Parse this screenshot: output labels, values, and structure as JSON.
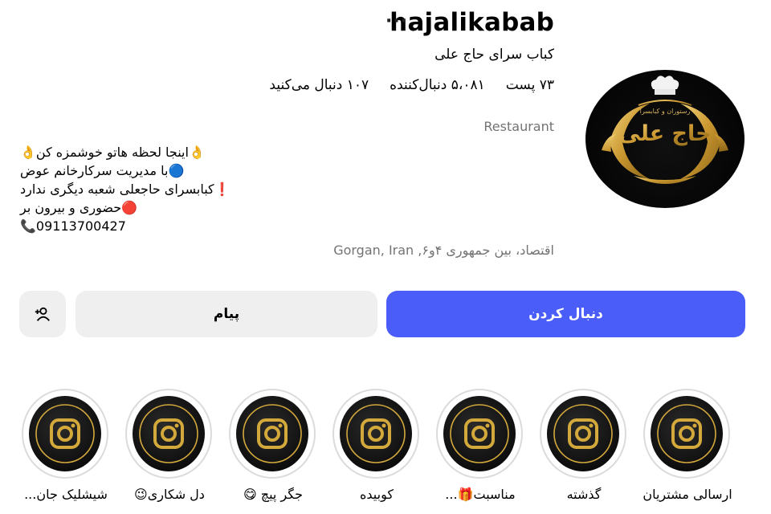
{
  "profile": {
    "username": "hajalikabab",
    "full_name": "کباب سرای حاج علی",
    "category": "Restaurant",
    "address": "اقتصاد، بین جمهوری ۴و۶, Gorgan, Iran",
    "avatar_text_top": "رستوران و کبابسرا",
    "avatar_text_main": "حاج علی"
  },
  "stats": {
    "posts": "۷۳ پست",
    "followers": "۵،۰۸۱ دنبال‌کننده",
    "following": "۱۰۷ دنبال می‌کنید"
  },
  "bio": [
    "👌اینجا لحظه هاتو خوشمزه کن👌",
    "🔵با مدیریت سرکارخانم عوض",
    "❗️کبابسرای حاجعلی شعبه دیگری ندارد",
    "🔴حضوری و بیرون بر",
    "📞09113700427"
  ],
  "buttons": {
    "follow": "دنبال کردن",
    "message": "پیام",
    "add_user_icon": "add-person-icon",
    "more_icon": "more-horizontal-icon"
  },
  "highlights": [
    {
      "label": "ارسالی مشتریان",
      "icon": "instagram-icon"
    },
    {
      "label": "گذشته",
      "icon": "instagram-icon"
    },
    {
      "label": "مناسبت🎁...",
      "icon": "instagram-icon"
    },
    {
      "label": "کوبیده",
      "icon": "instagram-icon"
    },
    {
      "label": "جگر پیچ 😋",
      "icon": "instagram-icon"
    },
    {
      "label": "دل شکاری😉",
      "icon": "instagram-icon"
    },
    {
      "label": "شیشلیک جان...",
      "icon": "instagram-icon"
    }
  ],
  "colors": {
    "accent": "#4a5df9",
    "secondary_button": "#efefef",
    "muted_text": "#737373",
    "gold": "#d4a93c"
  }
}
